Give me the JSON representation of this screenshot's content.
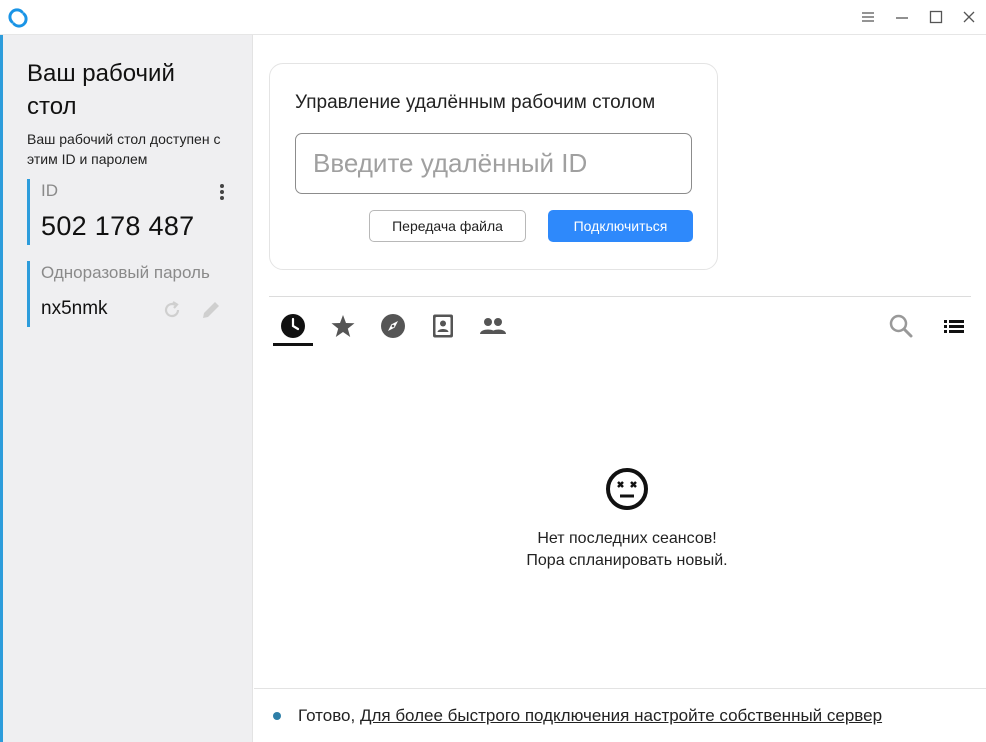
{
  "window": {
    "icons": [
      "app-logo-icon",
      "hamburger-menu-icon",
      "minimize-icon",
      "maximize-icon",
      "close-icon"
    ]
  },
  "sidebar": {
    "title": "Ваш рабочий стол",
    "description": "Ваш рабочий стол доступен с этим ID и паролем",
    "id_label": "ID",
    "id_value": "502 178 487",
    "password_label": "Одноразовый пароль",
    "password_value": "nx5nmk",
    "accent_color": "#2d9cdb"
  },
  "connect": {
    "title": "Управление удалённым рабочим столом",
    "input_placeholder": "Введите удалённый ID",
    "input_value": "",
    "file_transfer_label": "Передача файла",
    "connect_label": "Подключиться",
    "connect_color": "#2e89fb"
  },
  "tabs": [
    {
      "icon": "recent-clock-icon",
      "active": true
    },
    {
      "icon": "favorites-star-icon",
      "active": false
    },
    {
      "icon": "discovered-compass-icon",
      "active": false
    },
    {
      "icon": "address-book-icon",
      "active": false
    },
    {
      "icon": "group-people-icon",
      "active": false
    }
  ],
  "tools": [
    "search-icon",
    "list-view-icon"
  ],
  "empty_state": {
    "icon": "dizzy-face-icon",
    "line1": "Нет последних сеансов!",
    "line2": "Пора спланировать новый."
  },
  "status": {
    "text": "Готово,",
    "link": "Для более быстрого подключения настройте собственный сервер",
    "dot_color": "#2e7fa8"
  }
}
